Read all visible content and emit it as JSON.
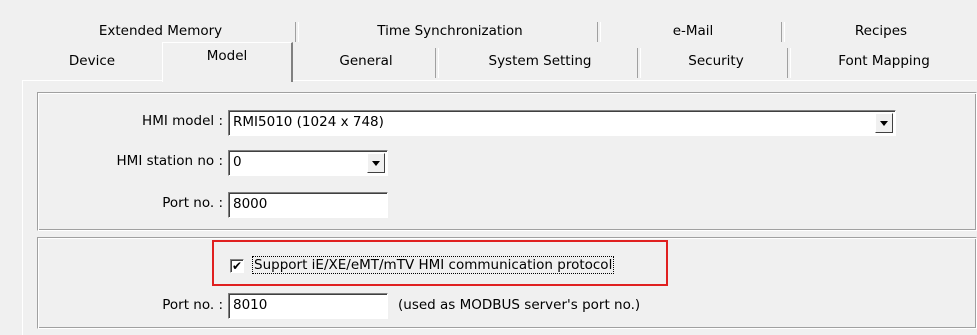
{
  "tabs_row1": [
    {
      "label": "Extended Memory"
    },
    {
      "label": "Time Synchronization"
    },
    {
      "label": "e-Mail"
    },
    {
      "label": "Recipes"
    }
  ],
  "tabs_row2": [
    {
      "label": "Device"
    },
    {
      "label": "Model",
      "selected": true
    },
    {
      "label": "General"
    },
    {
      "label": "System Setting"
    },
    {
      "label": "Security"
    },
    {
      "label": "Font Mapping"
    }
  ],
  "model_group": {
    "hmi_model_label": "HMI model :",
    "hmi_model_value": "RMI5010 (1024 x 748)",
    "station_label": "HMI station no :",
    "station_value": "0",
    "port_label": "Port no. :",
    "port_value": "8000"
  },
  "protocol_group": {
    "support_checked": true,
    "support_check_mark": "✔",
    "support_label": "Support iE/XE/eMT/mTV HMI communication protocol",
    "port_label": "Port no. :",
    "port_value": "8010",
    "port_note": "(used as MODBUS server's port no.)"
  },
  "colors": {
    "highlight": "#e02020",
    "window_bg": "#f0f0f0"
  }
}
